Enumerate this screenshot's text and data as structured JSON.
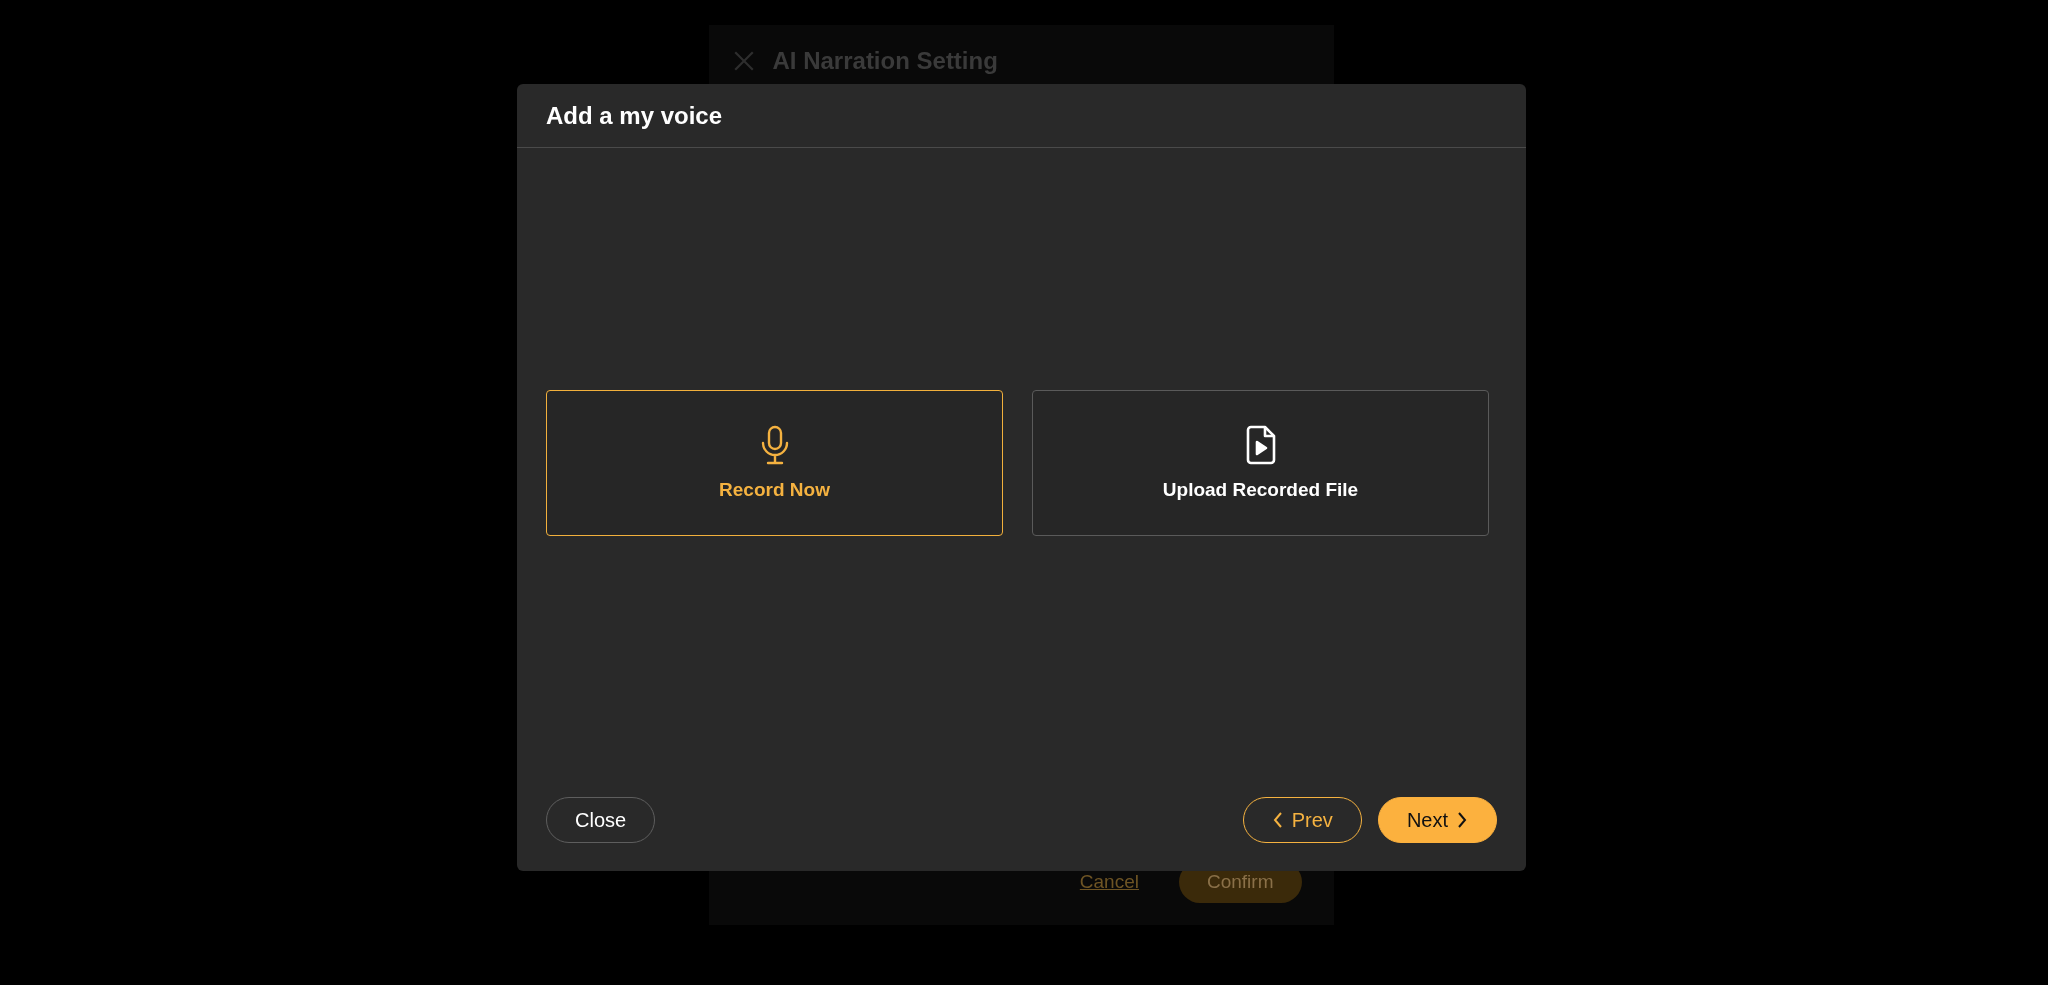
{
  "background_panel": {
    "title": "AI Narration Setting",
    "cancel_link": "Cancel",
    "confirm_button": "Confirm"
  },
  "dialog": {
    "title": "Add a my voice",
    "options": [
      {
        "kind": "microphone",
        "label": "Record Now",
        "selected": true
      },
      {
        "kind": "file",
        "label": "Upload Recorded File",
        "selected": false
      }
    ],
    "buttons": [
      {
        "kind": "close",
        "label": "Close"
      },
      {
        "kind": "prev",
        "label": "Prev"
      },
      {
        "kind": "next",
        "label": "Next"
      }
    ]
  }
}
